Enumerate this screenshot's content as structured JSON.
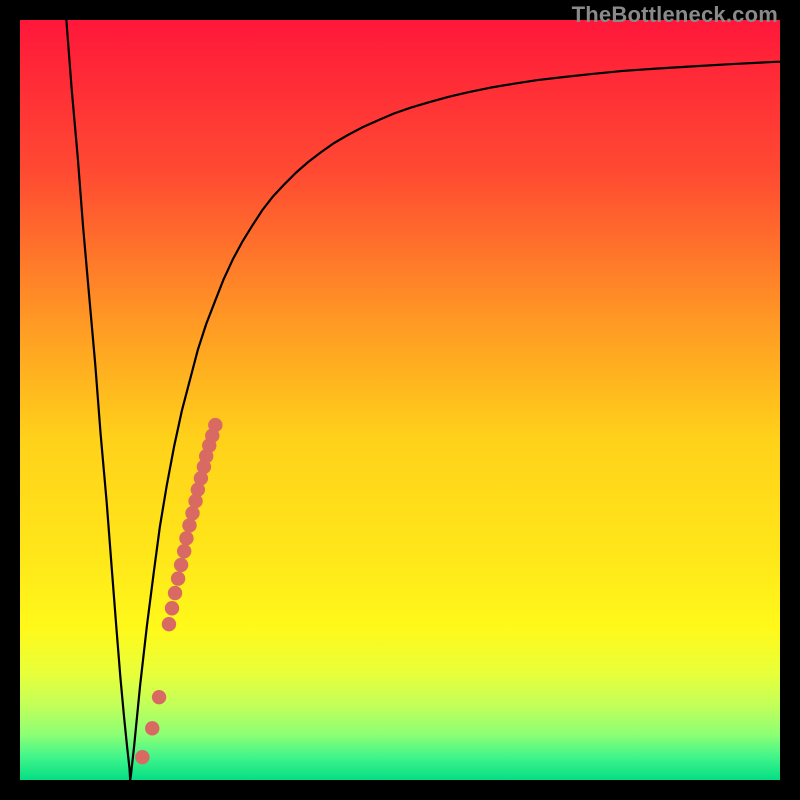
{
  "watermark": "TheBottleneck.com",
  "colors": {
    "frame": "#000000",
    "curve": "#000000",
    "dot": "#d86a63"
  },
  "chart_data": {
    "type": "line",
    "title": "",
    "xlabel": "",
    "ylabel": "",
    "xlim": [
      0,
      100
    ],
    "ylim": [
      0,
      100
    ],
    "grid": false,
    "legend": false,
    "gradient_stops": [
      {
        "offset": 0.0,
        "color": "#ff173a"
      },
      {
        "offset": 0.2,
        "color": "#ff4a32"
      },
      {
        "offset": 0.4,
        "color": "#ff9a24"
      },
      {
        "offset": 0.55,
        "color": "#ffd11a"
      },
      {
        "offset": 0.72,
        "color": "#ffe91a"
      },
      {
        "offset": 0.8,
        "color": "#fff91a"
      },
      {
        "offset": 0.86,
        "color": "#e8ff3a"
      },
      {
        "offset": 0.9,
        "color": "#c4ff58"
      },
      {
        "offset": 0.94,
        "color": "#8dff74"
      },
      {
        "offset": 0.97,
        "color": "#40f58a"
      },
      {
        "offset": 1.0,
        "color": "#05dd84"
      }
    ],
    "series": [
      {
        "name": "bottleneck-curve",
        "x": [
          6.1,
          6.8,
          7.6,
          8.3,
          9.1,
          9.9,
          10.6,
          11.4,
          12.1,
          12.7,
          13.2,
          13.7,
          14.1,
          14.4,
          14.5,
          14.6,
          15.0,
          15.8,
          16.7,
          17.6,
          18.4,
          19.3,
          20.3,
          21.3,
          22.4,
          23.4,
          24.5,
          25.7,
          26.8,
          28.0,
          29.3,
          30.6,
          31.9,
          33.3,
          34.8,
          36.3,
          37.9,
          39.6,
          41.3,
          43.2,
          45.1,
          47.1,
          49.2,
          51.5,
          53.9,
          56.4,
          59.0,
          61.9,
          64.9,
          68.1,
          71.6,
          75.3,
          79.3,
          83.7,
          88.5,
          93.7,
          99.5,
          100.0
        ],
        "y": [
          100.0,
          90.9,
          81.9,
          72.8,
          63.7,
          54.7,
          45.6,
          36.6,
          27.5,
          19.8,
          13.6,
          8.2,
          4.3,
          1.6,
          0.0,
          0.7,
          4.3,
          12.4,
          20.3,
          27.3,
          33.3,
          38.7,
          44.0,
          48.6,
          52.8,
          56.6,
          60.0,
          63.1,
          65.9,
          68.5,
          70.9,
          73.0,
          75.0,
          76.8,
          78.4,
          79.9,
          81.3,
          82.6,
          83.8,
          84.9,
          85.9,
          86.8,
          87.7,
          88.5,
          89.2,
          89.9,
          90.5,
          91.1,
          91.6,
          92.1,
          92.5,
          92.9,
          93.3,
          93.6,
          93.9,
          94.2,
          94.5,
          94.5
        ]
      }
    ],
    "dot_cluster": {
      "name": "highlighted-points",
      "points": [
        {
          "x": 16.1,
          "y": 3.0
        },
        {
          "x": 17.4,
          "y": 6.8
        },
        {
          "x": 18.3,
          "y": 10.9
        },
        {
          "x": 19.6,
          "y": 20.5
        },
        {
          "x": 20.0,
          "y": 22.6
        },
        {
          "x": 20.4,
          "y": 24.6
        },
        {
          "x": 20.8,
          "y": 26.5
        },
        {
          "x": 21.2,
          "y": 28.3
        },
        {
          "x": 21.6,
          "y": 30.1
        },
        {
          "x": 21.9,
          "y": 31.8
        },
        {
          "x": 22.3,
          "y": 33.5
        },
        {
          "x": 22.7,
          "y": 35.1
        },
        {
          "x": 23.1,
          "y": 36.7
        },
        {
          "x": 23.4,
          "y": 38.2
        },
        {
          "x": 23.8,
          "y": 39.7
        },
        {
          "x": 24.2,
          "y": 41.2
        },
        {
          "x": 24.5,
          "y": 42.6
        },
        {
          "x": 24.9,
          "y": 44.0
        },
        {
          "x": 25.3,
          "y": 45.3
        },
        {
          "x": 25.7,
          "y": 46.7
        }
      ]
    }
  }
}
